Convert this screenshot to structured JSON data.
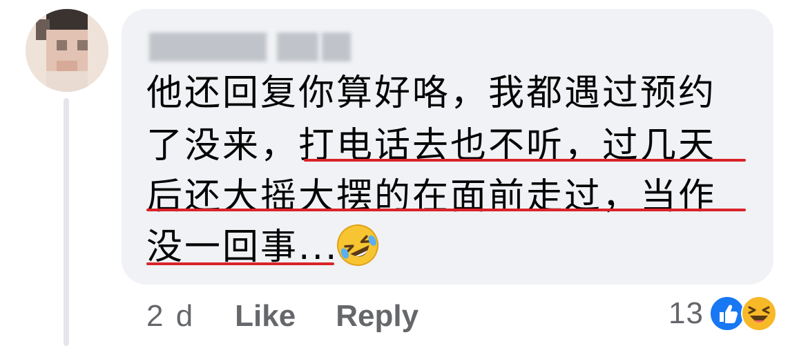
{
  "comment": {
    "lines": [
      "他还回复你算好咯，我都遇过预约",
      "了没来，打电话去也不听，过几天",
      "后还大摇大摆的在面前走过，当作",
      "没一回事..."
    ],
    "emoji": "rolling-on-the-floor-laughing"
  },
  "actions": {
    "time": "2 d",
    "like_label": "Like",
    "reply_label": "Reply"
  },
  "reactions": {
    "count": "13",
    "types": [
      "like",
      "haha"
    ]
  },
  "colors": {
    "bubble": "#f0f2f5",
    "underline": "#d9232a",
    "meta_text": "#65676b",
    "like_blue": "#1877f2",
    "haha_yellow": "#f7b928"
  }
}
